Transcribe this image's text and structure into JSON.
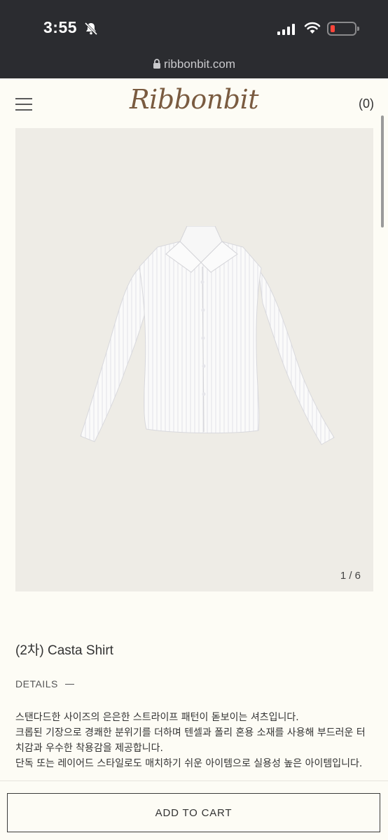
{
  "status_bar": {
    "time": "3:55"
  },
  "browser": {
    "url": "ribbonbit.com"
  },
  "header": {
    "logo": "Ribbonbit",
    "cart_count": "(0)"
  },
  "product": {
    "pager": "1 / 6",
    "title": "(2차) Casta Shirt",
    "details_label": "DETAILS",
    "description_lines": [
      "스탠다드한 사이즈의 은은한 스트라이프 패턴이 돋보이는 셔츠입니다.",
      "크롭된 기장으로 경쾌한 분위기를 더하며 텐셀과 폴리 혼용 소재를 사용해 부드러운 터",
      "치감과 우수한 착용감을 제공합니다.",
      "단독 또는 레이어드 스타일로도 매치하기 쉬운 아이템으로 실용성 높은 아이템입니다."
    ]
  },
  "actions": {
    "add_to_cart": "ADD TO CART"
  },
  "colors": {
    "background": "#fdfcf5",
    "logo": "#7a5b40",
    "status_bar": "#2b2c30",
    "battery_low": "#ff453a"
  }
}
